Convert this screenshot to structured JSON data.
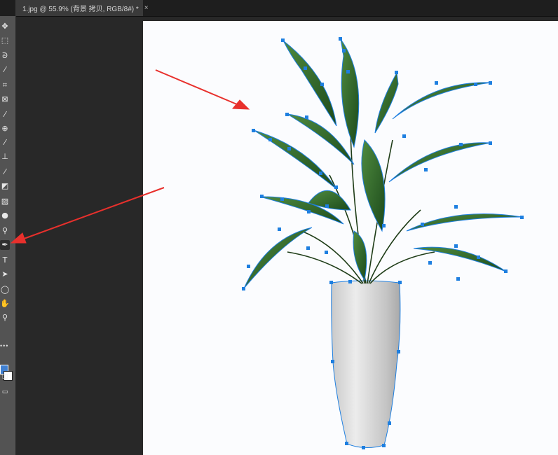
{
  "tab": {
    "title": "1.jpg @ 55.9% (背景 拷贝, RGB/8#) *",
    "close_label": "×"
  },
  "toolbar": {
    "tools": [
      {
        "name": "move-tool",
        "glyph": "✥"
      },
      {
        "name": "marquee-tool",
        "glyph": "⬚"
      },
      {
        "name": "lasso-tool",
        "glyph": "ᘐ"
      },
      {
        "name": "quick-select-tool",
        "glyph": "⁄"
      },
      {
        "name": "crop-tool",
        "glyph": "⌗"
      },
      {
        "name": "frame-tool",
        "glyph": "⊠"
      },
      {
        "name": "eyedropper-tool",
        "glyph": "⁄"
      },
      {
        "name": "healing-brush-tool",
        "glyph": "⊕"
      },
      {
        "name": "brush-tool",
        "glyph": "⁄"
      },
      {
        "name": "clone-stamp-tool",
        "glyph": "⊥"
      },
      {
        "name": "history-brush-tool",
        "glyph": "⁄"
      },
      {
        "name": "eraser-tool",
        "glyph": "◩"
      },
      {
        "name": "gradient-tool",
        "glyph": "▨"
      },
      {
        "name": "blur-tool",
        "glyph": "●"
      },
      {
        "name": "dodge-tool",
        "glyph": "⚲"
      },
      {
        "name": "pen-tool",
        "glyph": "✒"
      },
      {
        "name": "type-tool",
        "glyph": "T"
      },
      {
        "name": "path-selection-tool",
        "glyph": "➤"
      },
      {
        "name": "ellipse-tool",
        "glyph": "◯"
      },
      {
        "name": "hand-tool",
        "glyph": "✋"
      },
      {
        "name": "zoom-tool",
        "glyph": "⚲"
      }
    ],
    "active_tool": "pen-tool",
    "more_glyph": "•••",
    "foreground_color": "#3f7fd0",
    "background_color": "#ffffff"
  },
  "colors": {
    "path_handle": "#1e7fe0",
    "arrow": "#e8302c",
    "vase": "#d9d9d9",
    "leaf": "#2d6b2a"
  }
}
